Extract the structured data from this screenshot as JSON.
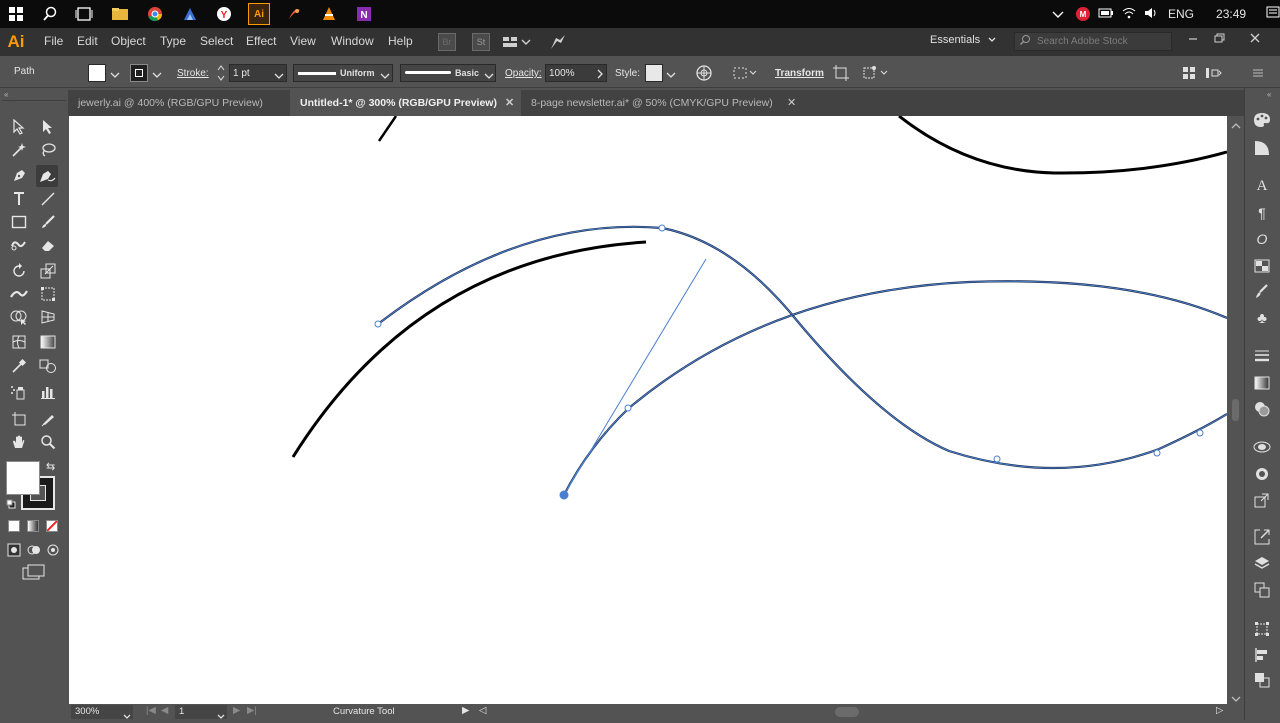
{
  "taskbar": {
    "language": "ENG",
    "time": "23:49"
  },
  "app": {
    "logo": "Ai",
    "menus": [
      "File",
      "Edit",
      "Object",
      "Type",
      "Select",
      "Effect",
      "View",
      "Window",
      "Help"
    ],
    "bridge_label": "Br",
    "stock_label": "St",
    "workspace": "Essentials",
    "search_placeholder": "Search Adobe Stock"
  },
  "control_bar": {
    "selection_type": "Path",
    "stroke_label": "Stroke:",
    "stroke_weight": "1 pt",
    "profile": "Uniform",
    "brush": "Basic",
    "opacity_label": "Opacity:",
    "opacity_value": "100%",
    "style_label": "Style:",
    "transform_label": "Transform"
  },
  "tabs": [
    {
      "label": "jewerly.ai @ 400% (RGB/GPU Preview)",
      "active": false
    },
    {
      "label": "Untitled-1* @ 300% (RGB/GPU Preview)",
      "active": true
    },
    {
      "label": "8-page newsletter.ai* @ 50% (CMYK/GPU Preview)",
      "active": false
    }
  ],
  "status_bar": {
    "zoom": "300%",
    "artboard": "1",
    "current_tool": "Curvature Tool"
  },
  "colors": {
    "accent_orange": "#ff9a00",
    "path_highlight": "#4a7fd0",
    "ui_dark": "#323232",
    "ui_mid": "#535353"
  }
}
